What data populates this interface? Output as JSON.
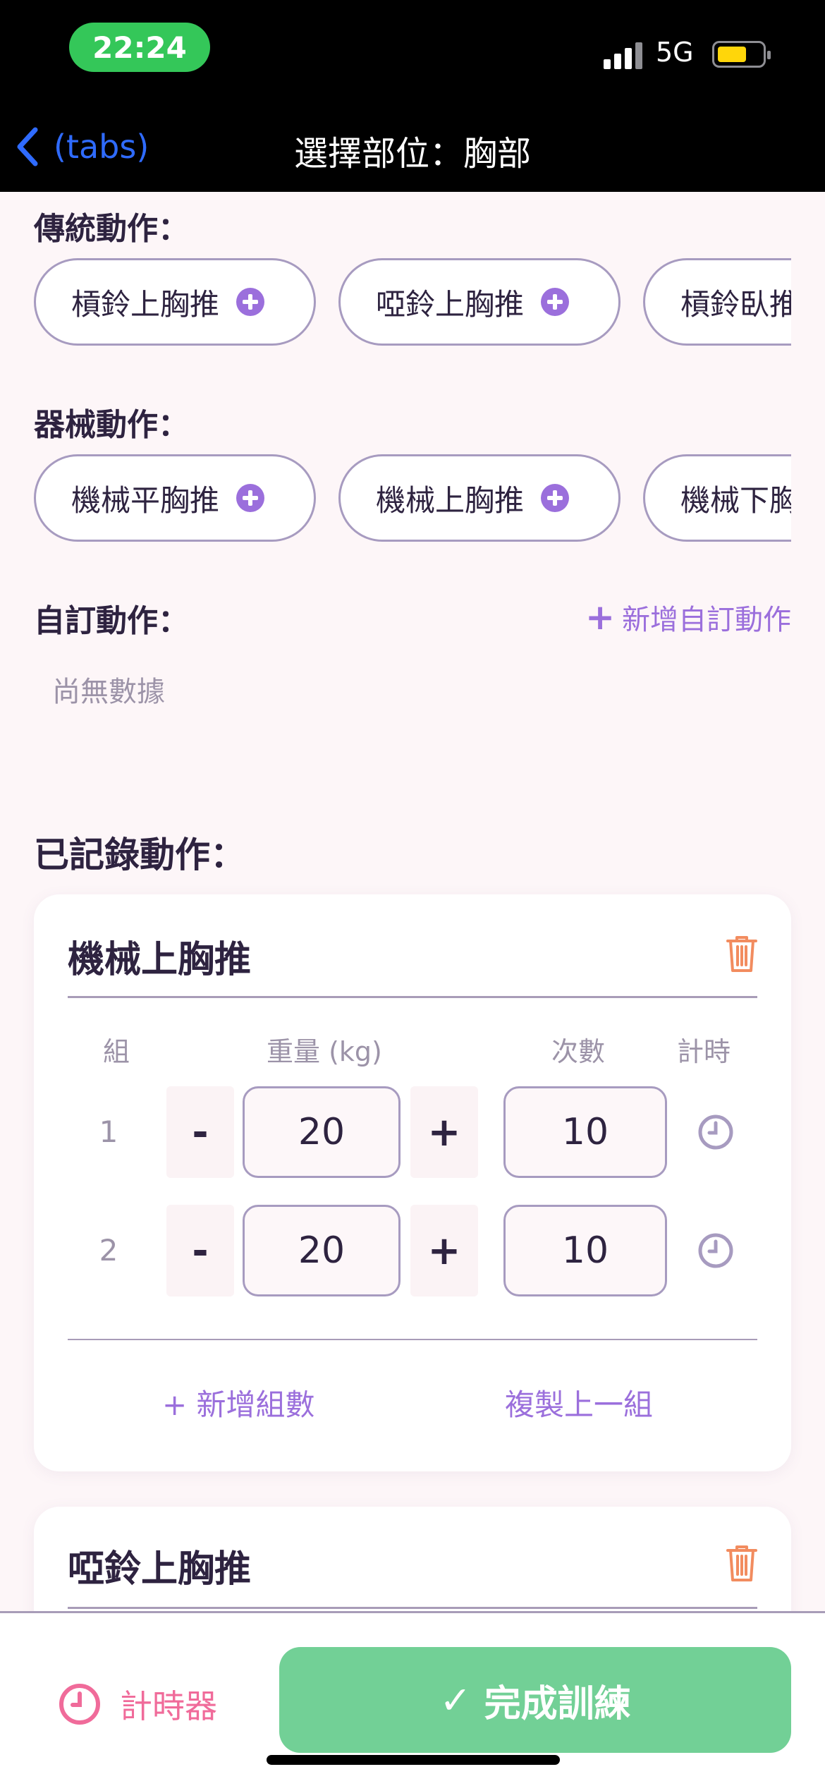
{
  "status_bar": {
    "time": "22:24",
    "network": "5G"
  },
  "nav": {
    "back_label": "(tabs)",
    "title": "選擇部位：胸部"
  },
  "sections": {
    "traditional": {
      "title": "傳統動作：",
      "chips": [
        "槓鈴上胸推",
        "啞鈴上胸推",
        "槓鈴臥推"
      ]
    },
    "machine": {
      "title": "器械動作：",
      "chips": [
        "機械平胸推",
        "機械上胸推",
        "機械下胸推"
      ]
    },
    "custom": {
      "title": "自訂動作：",
      "add_label": "新增自訂動作",
      "add_symbol": "+",
      "empty_text": "尚無數據"
    },
    "recorded": {
      "title": "已記錄動作："
    }
  },
  "recorded_exercises": [
    {
      "name": "機械上胸推",
      "columns": {
        "set": "組",
        "weight": "重量 (kg)",
        "reps": "次數",
        "timer": "計時"
      },
      "sets": [
        {
          "set": "1",
          "weight": "20",
          "reps": "10"
        },
        {
          "set": "2",
          "weight": "20",
          "reps": "10"
        }
      ],
      "minus_label": "-",
      "plus_label": "+",
      "add_set_label": "+ 新增組數",
      "copy_set_label": "複製上一組"
    },
    {
      "name": "啞鈴上胸推"
    }
  ],
  "bottom_bar": {
    "timer_label": "計時器",
    "finish_check": "✓",
    "finish_label": "完成訓練"
  },
  "colors": {
    "accent": "#9b6fdc",
    "finish": "#72d096",
    "timer": "#f06b9a",
    "trash": "#f28c5f",
    "nav_link": "#2f6bff"
  }
}
